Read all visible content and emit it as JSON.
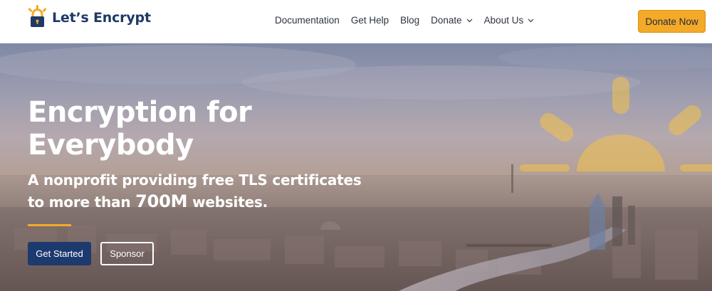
{
  "header": {
    "logo_text": "Let’s Encrypt",
    "nav": [
      {
        "label": "Documentation",
        "has_dropdown": false
      },
      {
        "label": "Get Help",
        "has_dropdown": false
      },
      {
        "label": "Blog",
        "has_dropdown": false
      },
      {
        "label": "Donate",
        "has_dropdown": true
      },
      {
        "label": "About Us",
        "has_dropdown": true
      }
    ],
    "donate_now_label": "Donate Now"
  },
  "hero": {
    "title_line1": "Encryption for",
    "title_line2": "Everybody",
    "subtitle_line1": "A nonprofit providing free TLS certificates",
    "subtitle_pre": "to more than ",
    "subtitle_number": "700M",
    "subtitle_post": " websites.",
    "get_started_label": "Get Started",
    "sponsor_label": "Sponsor"
  },
  "colors": {
    "brand_navy": "#1d3a66",
    "accent_yellow": "#f4a928",
    "button_navy": "#1d3a6e"
  }
}
